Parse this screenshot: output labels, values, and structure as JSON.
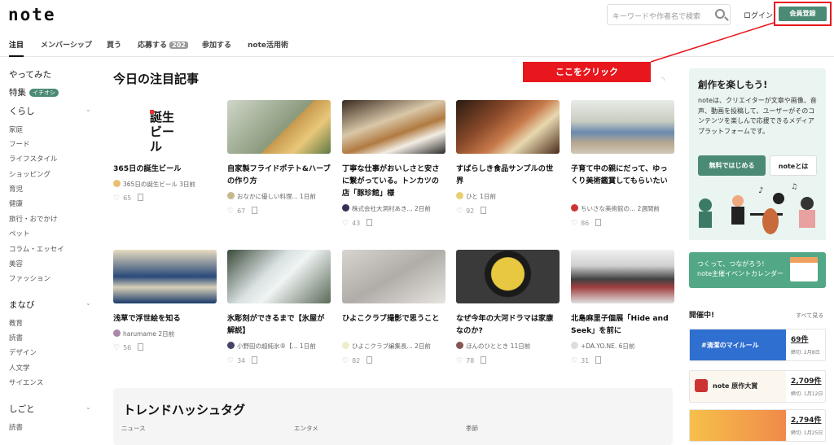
{
  "header": {
    "logo": "note",
    "search_placeholder": "キーワードや作者名で検索",
    "login": "ログイン",
    "signup": "会員登録"
  },
  "tabs": [
    {
      "label": "注目"
    },
    {
      "label": "メンバーシップ"
    },
    {
      "label": "買う"
    },
    {
      "label": "応募する",
      "count": "202"
    },
    {
      "label": "参加する"
    },
    {
      "label": "note活用術"
    }
  ],
  "sidebar": {
    "items": [
      {
        "label": "やってみた"
      },
      {
        "label": "特集",
        "badge": "イチオシ"
      },
      {
        "label": "くらし"
      },
      {
        "label": "家庭"
      },
      {
        "label": "フード"
      },
      {
        "label": "ライフスタイル"
      },
      {
        "label": "ショッピング"
      },
      {
        "label": "育児"
      },
      {
        "label": "健康"
      },
      {
        "label": "旅行・おでかけ"
      },
      {
        "label": "ペット"
      },
      {
        "label": "コラム・エッセイ"
      },
      {
        "label": "美容"
      },
      {
        "label": "ファッション"
      },
      {
        "label": "まなび"
      },
      {
        "label": "教育"
      },
      {
        "label": "読書"
      },
      {
        "label": "デザイン"
      },
      {
        "label": "人文学"
      },
      {
        "label": "サイエンス"
      },
      {
        "label": "しごと"
      },
      {
        "label": "読書"
      }
    ]
  },
  "main": {
    "title": "今日の注目記事",
    "annotation": "ここをクリック",
    "cards": [
      {
        "title": "365日の誕生ビール",
        "author": "365日の誕生ビール",
        "date": "3日前",
        "likes": "65"
      },
      {
        "title": "自家製フライドポテト&ハーブの作り方",
        "author": "おなかに優しい料理...",
        "date": "1日前",
        "likes": "67"
      },
      {
        "title": "丁寧な仕事がおいしさと安さに繋がっている。トンカツの店「豚珍館」様",
        "author": "株式会社大洞村あき...",
        "date": "2日前",
        "likes": "43"
      },
      {
        "title": "すばらしき食品サンプルの世界",
        "author": "ひと",
        "date": "1日前",
        "likes": "92"
      },
      {
        "title": "子育て中の親にだって、ゆっくり美術鑑賞してもらいたい",
        "author": "ちいさな美術館の...",
        "date": "2週間前",
        "likes": "86"
      },
      {
        "title": "浅草で浮世絵を知る",
        "author": "harumame",
        "date": "2日前",
        "likes": "56"
      },
      {
        "title": "氷彫刻ができるまで【氷屋が解説】",
        "author": "小野田の超純氷®【...",
        "date": "1日前",
        "likes": "34"
      },
      {
        "title": "ひよこクラブ撮影で思うこと",
        "author": "ひよこクラブ編集長...",
        "date": "2日前",
        "likes": "82"
      },
      {
        "title": "なぜ今年の大河ドラマは家康なのか?",
        "author": "ほんのひととき",
        "date": "11日前",
        "likes": "78"
      },
      {
        "title": "北島麻里子個展「Hide and Seek」を前に",
        "author": "+DA.YO.NE.",
        "date": "6日前",
        "likes": "31"
      }
    ],
    "thumb1_text": "誕生\nビール"
  },
  "trend": {
    "title": "トレンドハッシュタグ",
    "categories": [
      "ニュース",
      "エンタメ",
      "季節"
    ]
  },
  "right": {
    "promo_title": "創作を楽しもう!",
    "promo_text": "noteは、クリエイターが文章や画像、音声、動画を投稿して、ユーザーがそのコンテンツを楽しんで応援できるメディアプラットフォームです。",
    "btn_free": "無料ではじめる",
    "btn_about": "noteとは",
    "event_banner": "つくって、つながろう!\nnote主催イベントカレンダー",
    "kaisai": "開催中!",
    "seeall": "すべて見る",
    "events": [
      {
        "name": "#清潔のマイルール",
        "count": "69件",
        "date": "締切: 2月8日"
      },
      {
        "name": "note 原作大賞",
        "count": "2,709件",
        "date": "締切: 1月12日"
      },
      {
        "name": "",
        "count": "2,794件",
        "date": "締切: 1月25日"
      }
    ]
  },
  "colors": {
    "brand": "#4b8a74",
    "annotation": "#e8161d"
  }
}
